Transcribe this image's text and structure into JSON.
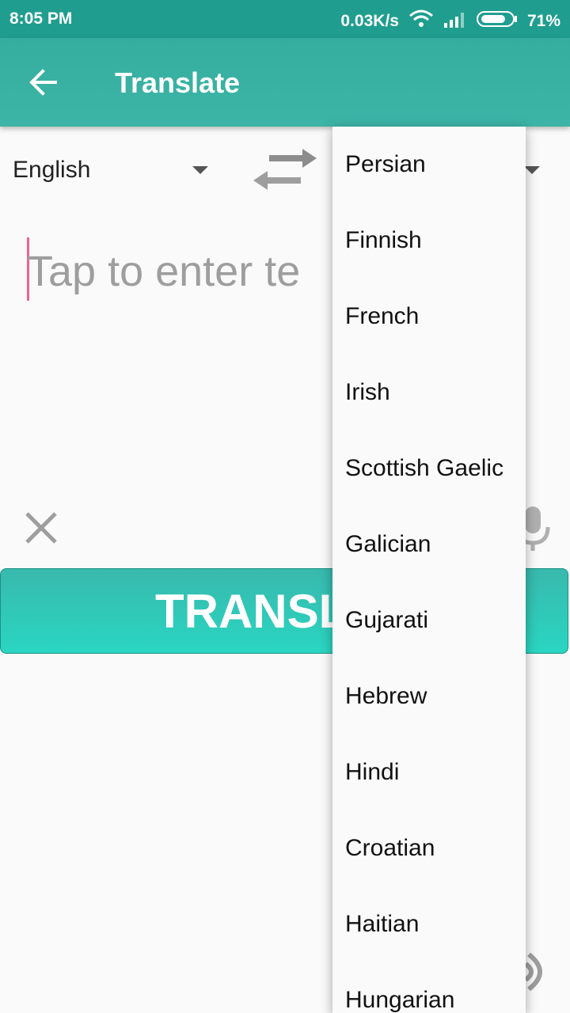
{
  "status_bar": {
    "time": "8:05 PM",
    "network_speed": "0.03K/s",
    "battery": "71%"
  },
  "app_bar": {
    "title": "Translate"
  },
  "languages": {
    "source": "English",
    "swap_icon": "swap-arrows-icon"
  },
  "input": {
    "placeholder": "Tap to enter te"
  },
  "translate_button": {
    "label": "TRANSL"
  },
  "dropdown": {
    "items": [
      "Persian",
      "Finnish",
      "French",
      "Irish",
      "Scottish Gaelic",
      "Galician",
      "Gujarati",
      "Hebrew",
      "Hindi",
      "Croatian",
      "Haitian",
      "Hungarian"
    ]
  },
  "colors": {
    "primary": "#3cb4a6",
    "accent": "#2ad6c2",
    "cursor": "#f06292"
  }
}
